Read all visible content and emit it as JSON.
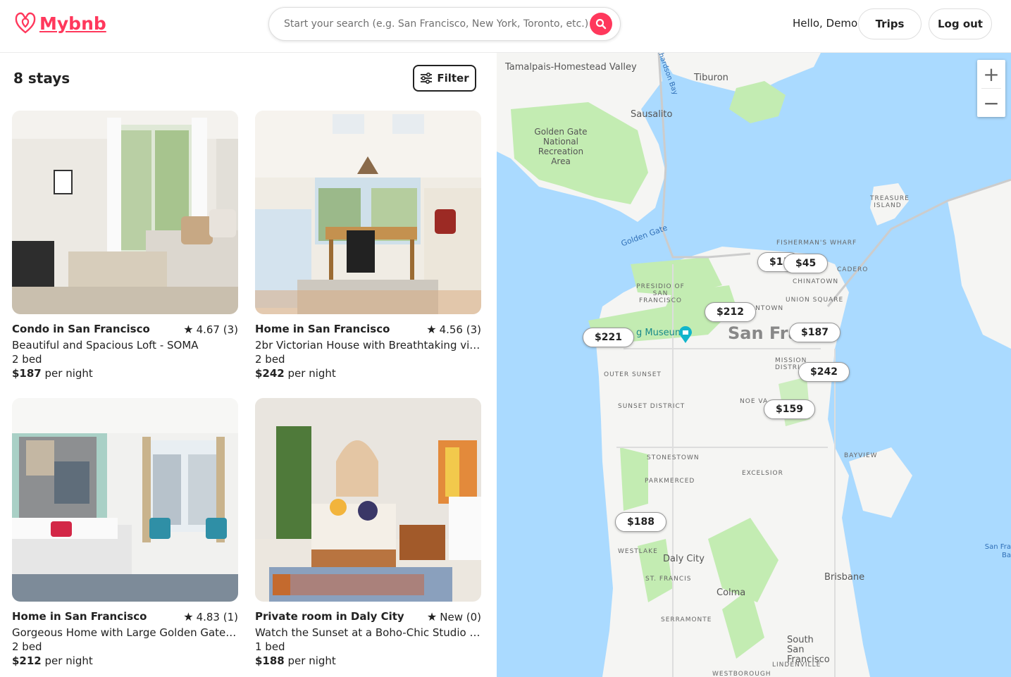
{
  "header": {
    "brand": "Mybnb",
    "search_placeholder": "Start your search (e.g. San Francisco, New York, Toronto, etc.)",
    "greeting": "Hello, Demo",
    "trips_label": "Trips",
    "logout_label": "Log out"
  },
  "results": {
    "count_label": "8 stays",
    "filter_label": "Filter"
  },
  "listings": [
    {
      "title": "Condo in San Francisco",
      "rating": "4.67 (3)",
      "description": "Beautiful and Spacious Loft - SOMA",
      "beds": "2 bed",
      "price": "$187",
      "per": "per night"
    },
    {
      "title": "Home in San Francisco",
      "rating": "4.56 (3)",
      "description": "2br Victorian House with Breathtaking views",
      "beds": "2 bed",
      "price": "$242",
      "per": "per night"
    },
    {
      "title": "Home in San Francisco",
      "rating": "4.83 (1)",
      "description": "Gorgeous Home with Large Golden Gate Br...",
      "beds": "2 bed",
      "price": "$212",
      "per": "per night"
    },
    {
      "title": "Private room in Daly City",
      "rating": "New (0)",
      "description": "Watch the Sunset at a Boho-Chic Studio wi...",
      "beds": "1 bed",
      "price": "$188",
      "per": "per night"
    }
  ],
  "map": {
    "markers": [
      "$1!",
      "$45",
      "$212",
      "$187",
      "$221",
      "$242",
      "$159",
      "$188"
    ],
    "zoom_in": "+",
    "zoom_out": "−",
    "labels": {
      "tamalpais": "Tamalpais-Homestead Valley",
      "tiburon": "Tiburon",
      "sausalito": "Sausalito",
      "ggnra": "Golden Gate National Recreation Area",
      "golden_gate": "Golden Gate",
      "richardson": "chardson Bay",
      "treasure": "TREASURE ISLAND",
      "fishermans": "FISHERMAN'S WHARF",
      "embarcadero": "CADERO",
      "chinatown": "CHINATOWN",
      "presidio": "PRESIDIO OF SAN FRANCISCO",
      "union_square": "UNION SQUARE",
      "downtown": "ANTOWN",
      "museum": "g Museum",
      "sf": "San Franc    o",
      "outer_sunset": "OUTER SUNSET",
      "mission": "MISSION DISTRICT",
      "noe": "NOE VA",
      "sunset": "SUNSET DISTRICT",
      "stonestown": "STONESTOWN",
      "bayview": "BAYVIEW",
      "excelsior": "EXCELSIOR",
      "parkmerced": "PARKMERCED",
      "westlake": "WESTLAKE",
      "daly_city": "Daly City",
      "st_francis": "ST. FRANCIS",
      "brisbane": "Brisbane",
      "colma": "Colma",
      "serramonte": "SERRAMONTE",
      "ssf": "South San Francisco",
      "lindenville": "LINDENVILLE",
      "westborough": "WESTBOROUGH",
      "sf_bay": "San Fra Ba"
    }
  },
  "colors": {
    "brand": "#ff385c",
    "water": "#aadaff",
    "land": "#f5f5f3",
    "park": "#c3ecb2"
  }
}
